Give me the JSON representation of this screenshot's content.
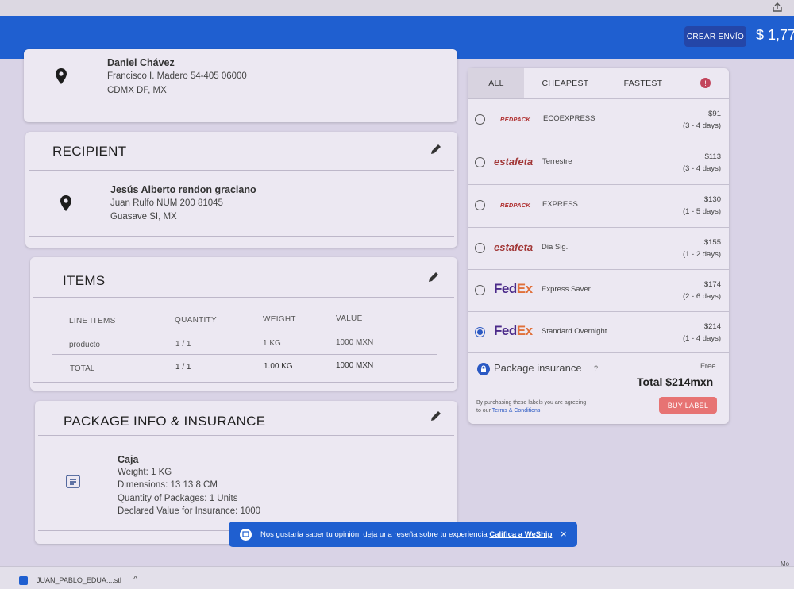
{
  "header": {
    "create_button": "CREAR ENVÍO",
    "balance": "$ 1,77"
  },
  "sender": {
    "name": "Daniel Chávez",
    "line1": "Francisco I. Madero 54-405 06000",
    "line2": "CDMX DF, MX"
  },
  "recipient": {
    "title": "RECIPIENT",
    "name": "Jesús Alberto rendon graciano",
    "line1": "Juan Rulfo NUM 200 81045",
    "line2": "Guasave SI, MX"
  },
  "items": {
    "title": "ITEMS",
    "columns": [
      "LINE ITEMS",
      "QUANTITY",
      "WEIGHT",
      "VALUE"
    ],
    "rows": [
      [
        "producto",
        "1 / 1",
        "1 KG",
        "1000 MXN"
      ]
    ],
    "total": [
      "TOTAL",
      "1 / 1",
      "1.00 KG",
      "1000 MXN"
    ]
  },
  "package": {
    "title": "PACKAGE INFO & INSURANCE",
    "name": "Caja",
    "weight": "Weight: 1 KG",
    "dimensions": "Dimensions: 13 13 8 CM",
    "quantity": "Quantity of Packages: 1 Units",
    "declared": "Declared Value for Insurance: 1000"
  },
  "rates": {
    "tabs": [
      "ALL",
      "CHEAPEST",
      "FASTEST"
    ],
    "alert_badge": "!",
    "options": [
      {
        "carrier": "REDPACK",
        "service": "ECOEXPRESS",
        "price": "$91",
        "days": "(3 - 4 days)",
        "selected": false
      },
      {
        "carrier": "estafeta",
        "service": "Terrestre",
        "price": "$113",
        "days": "(3 - 4 days)",
        "selected": false
      },
      {
        "carrier": "REDPACK",
        "service": "EXPRESS",
        "price": "$130",
        "days": "(1 - 5 days)",
        "selected": false
      },
      {
        "carrier": "estafeta",
        "service": "Dia Sig.",
        "price": "$155",
        "days": "(1 - 2 days)",
        "selected": false
      },
      {
        "carrier": "FedEx",
        "service": "Express Saver",
        "price": "$174",
        "days": "(2 - 6 days)",
        "selected": false
      },
      {
        "carrier": "FedEx",
        "service": "Standard Overnight",
        "price": "$214",
        "days": "(1 - 4 days)",
        "selected": true
      }
    ],
    "insurance_label": "Package insurance",
    "insurance_help": "?",
    "insurance_value": "Free",
    "total": "Total $214mxn",
    "terms_text": "By purchasing these labels you are agreeing to our",
    "terms_link": "Terms & Conditions",
    "buy_label": "BUY LABEL"
  },
  "toast": {
    "message": "Nos gustaría saber tu opinión, deja una reseña sobre tu experiencia",
    "link": "Califica a WeShip",
    "close": "×"
  },
  "downloads": {
    "file": "JUAN_PABLO_EDUA....stl",
    "right_text": "Mo"
  }
}
